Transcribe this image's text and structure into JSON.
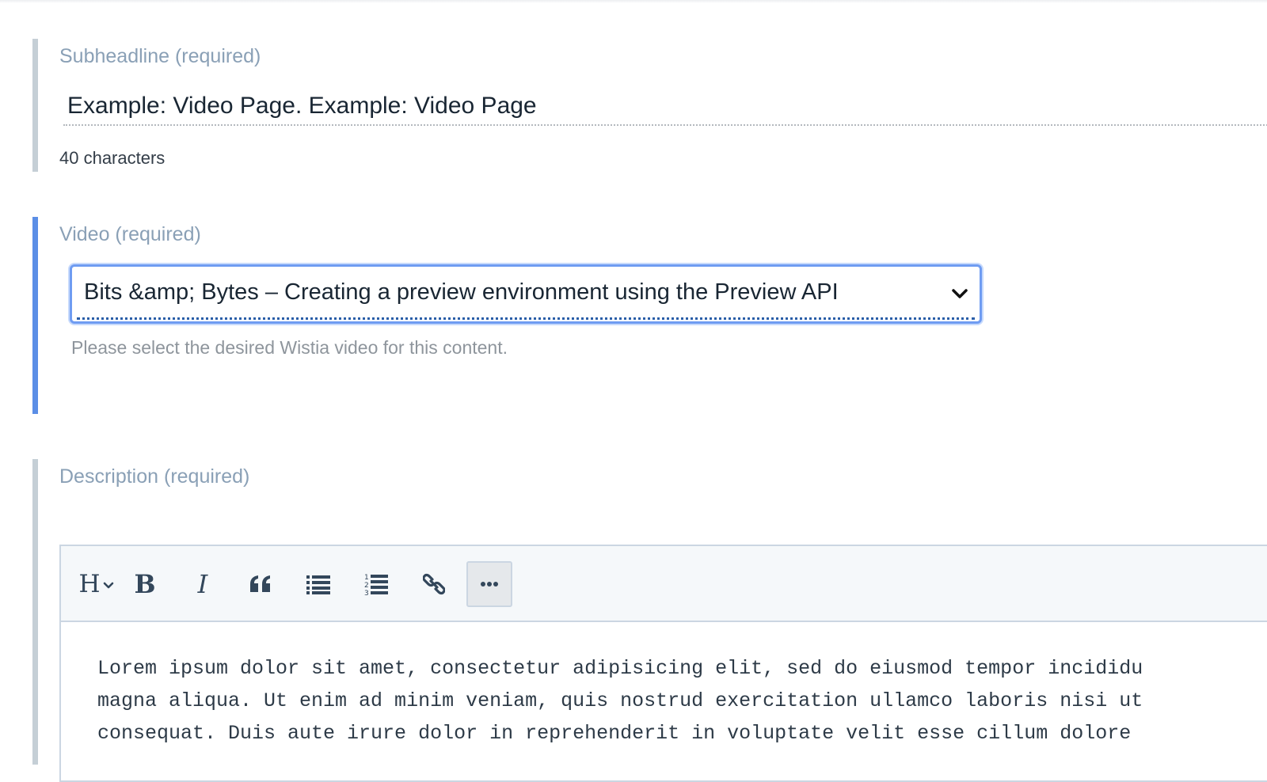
{
  "subheadline": {
    "label": "Subheadline (required)",
    "value": "Example: Video Page. Example: Video Page",
    "char_count": "40 characters"
  },
  "video": {
    "label": "Video (required)",
    "selected": "Bits &amp; Bytes – Creating a preview environment using the Preview API",
    "hint": "Please select the desired Wistia video for this content."
  },
  "description": {
    "label": "Description (required)",
    "toolbar": {
      "heading": "H",
      "bold": "B",
      "italic": "I",
      "buttons": [
        "heading-icon",
        "bold-icon",
        "italic-icon",
        "blockquote-icon",
        "bulleted-list-icon",
        "numbered-list-icon",
        "link-icon",
        "more-icon"
      ]
    },
    "body_lines": [
      "Lorem ipsum dolor sit amet, consectetur adipisicing elit, sed do eiusmod tempor incididu",
      "magna aliqua. Ut enim ad minim veniam, quis nostrud exercitation ullamco laboris nisi ut",
      "consequat. Duis aute irure dolor in reprehenderit in voluptate velit esse cillum dolore"
    ]
  },
  "colors": {
    "label": "#8aa0b6",
    "active_border": "#5b8ee6",
    "inactive_border": "#c5cfd6",
    "select_focus": "#6f9cf2",
    "toolbar_bg": "#f5f8fa"
  }
}
